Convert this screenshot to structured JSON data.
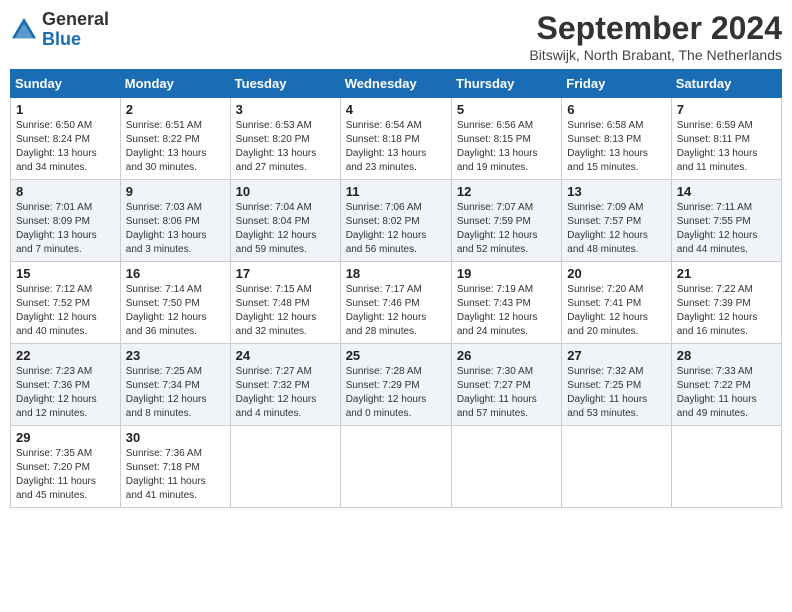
{
  "header": {
    "logo_general": "General",
    "logo_blue": "Blue",
    "month_title": "September 2024",
    "location": "Bitswijk, North Brabant, The Netherlands"
  },
  "weekdays": [
    "Sunday",
    "Monday",
    "Tuesday",
    "Wednesday",
    "Thursday",
    "Friday",
    "Saturday"
  ],
  "weeks": [
    [
      {
        "day": "1",
        "info": "Sunrise: 6:50 AM\nSunset: 8:24 PM\nDaylight: 13 hours\nand 34 minutes."
      },
      {
        "day": "2",
        "info": "Sunrise: 6:51 AM\nSunset: 8:22 PM\nDaylight: 13 hours\nand 30 minutes."
      },
      {
        "day": "3",
        "info": "Sunrise: 6:53 AM\nSunset: 8:20 PM\nDaylight: 13 hours\nand 27 minutes."
      },
      {
        "day": "4",
        "info": "Sunrise: 6:54 AM\nSunset: 8:18 PM\nDaylight: 13 hours\nand 23 minutes."
      },
      {
        "day": "5",
        "info": "Sunrise: 6:56 AM\nSunset: 8:15 PM\nDaylight: 13 hours\nand 19 minutes."
      },
      {
        "day": "6",
        "info": "Sunrise: 6:58 AM\nSunset: 8:13 PM\nDaylight: 13 hours\nand 15 minutes."
      },
      {
        "day": "7",
        "info": "Sunrise: 6:59 AM\nSunset: 8:11 PM\nDaylight: 13 hours\nand 11 minutes."
      }
    ],
    [
      {
        "day": "8",
        "info": "Sunrise: 7:01 AM\nSunset: 8:09 PM\nDaylight: 13 hours\nand 7 minutes."
      },
      {
        "day": "9",
        "info": "Sunrise: 7:03 AM\nSunset: 8:06 PM\nDaylight: 13 hours\nand 3 minutes."
      },
      {
        "day": "10",
        "info": "Sunrise: 7:04 AM\nSunset: 8:04 PM\nDaylight: 12 hours\nand 59 minutes."
      },
      {
        "day": "11",
        "info": "Sunrise: 7:06 AM\nSunset: 8:02 PM\nDaylight: 12 hours\nand 56 minutes."
      },
      {
        "day": "12",
        "info": "Sunrise: 7:07 AM\nSunset: 7:59 PM\nDaylight: 12 hours\nand 52 minutes."
      },
      {
        "day": "13",
        "info": "Sunrise: 7:09 AM\nSunset: 7:57 PM\nDaylight: 12 hours\nand 48 minutes."
      },
      {
        "day": "14",
        "info": "Sunrise: 7:11 AM\nSunset: 7:55 PM\nDaylight: 12 hours\nand 44 minutes."
      }
    ],
    [
      {
        "day": "15",
        "info": "Sunrise: 7:12 AM\nSunset: 7:52 PM\nDaylight: 12 hours\nand 40 minutes."
      },
      {
        "day": "16",
        "info": "Sunrise: 7:14 AM\nSunset: 7:50 PM\nDaylight: 12 hours\nand 36 minutes."
      },
      {
        "day": "17",
        "info": "Sunrise: 7:15 AM\nSunset: 7:48 PM\nDaylight: 12 hours\nand 32 minutes."
      },
      {
        "day": "18",
        "info": "Sunrise: 7:17 AM\nSunset: 7:46 PM\nDaylight: 12 hours\nand 28 minutes."
      },
      {
        "day": "19",
        "info": "Sunrise: 7:19 AM\nSunset: 7:43 PM\nDaylight: 12 hours\nand 24 minutes."
      },
      {
        "day": "20",
        "info": "Sunrise: 7:20 AM\nSunset: 7:41 PM\nDaylight: 12 hours\nand 20 minutes."
      },
      {
        "day": "21",
        "info": "Sunrise: 7:22 AM\nSunset: 7:39 PM\nDaylight: 12 hours\nand 16 minutes."
      }
    ],
    [
      {
        "day": "22",
        "info": "Sunrise: 7:23 AM\nSunset: 7:36 PM\nDaylight: 12 hours\nand 12 minutes."
      },
      {
        "day": "23",
        "info": "Sunrise: 7:25 AM\nSunset: 7:34 PM\nDaylight: 12 hours\nand 8 minutes."
      },
      {
        "day": "24",
        "info": "Sunrise: 7:27 AM\nSunset: 7:32 PM\nDaylight: 12 hours\nand 4 minutes."
      },
      {
        "day": "25",
        "info": "Sunrise: 7:28 AM\nSunset: 7:29 PM\nDaylight: 12 hours\nand 0 minutes."
      },
      {
        "day": "26",
        "info": "Sunrise: 7:30 AM\nSunset: 7:27 PM\nDaylight: 11 hours\nand 57 minutes."
      },
      {
        "day": "27",
        "info": "Sunrise: 7:32 AM\nSunset: 7:25 PM\nDaylight: 11 hours\nand 53 minutes."
      },
      {
        "day": "28",
        "info": "Sunrise: 7:33 AM\nSunset: 7:22 PM\nDaylight: 11 hours\nand 49 minutes."
      }
    ],
    [
      {
        "day": "29",
        "info": "Sunrise: 7:35 AM\nSunset: 7:20 PM\nDaylight: 11 hours\nand 45 minutes."
      },
      {
        "day": "30",
        "info": "Sunrise: 7:36 AM\nSunset: 7:18 PM\nDaylight: 11 hours\nand 41 minutes."
      },
      null,
      null,
      null,
      null,
      null
    ]
  ]
}
